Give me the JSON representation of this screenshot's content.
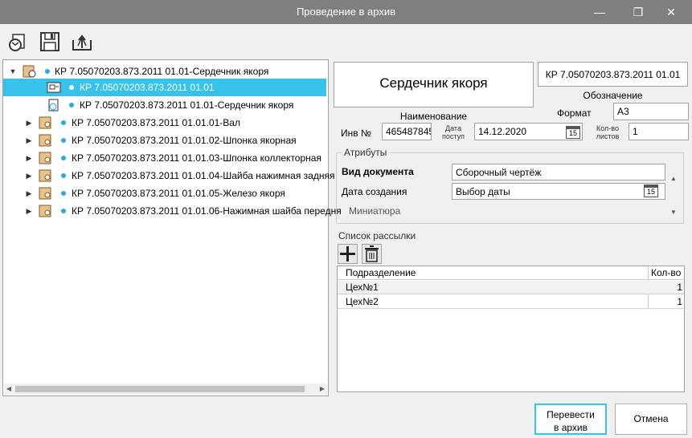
{
  "window": {
    "title": "Проведение в архив"
  },
  "tree": {
    "items": [
      {
        "label": "КР 7.05070203.873.2011 01.01-Сердечник якоря"
      },
      {
        "label": "КР 7.05070203.873.2011 01.01"
      },
      {
        "label": "КР 7.05070203.873.2011 01.01-Сердечник якоря"
      },
      {
        "label": "КР 7.05070203.873.2011 01.01.01-Вал"
      },
      {
        "label": "КР 7.05070203.873.2011 01.01.02-Шпонка якорная"
      },
      {
        "label": "КР 7.05070203.873.2011 01.01.03-Шпонка коллекторная"
      },
      {
        "label": "КР 7.05070203.873.2011 01.01.04-Шайба нажимная задняя"
      },
      {
        "label": "КР 7.05070203.873.2011 01.01.05-Железо якоря"
      },
      {
        "label": "КР 7.05070203.873.2011 01.01.06-Нажимная шайба передня"
      }
    ]
  },
  "card": {
    "name_value": "Сердечник якоря",
    "name_label": "Наименование",
    "designation_value": "КР 7.05070203.873.2011 01.01",
    "designation_label": "Обозначение",
    "format_label": "Формат",
    "format_value": "А3",
    "inv_label": "Инв №",
    "inv_value": "465487845",
    "date_label": "Дата поступ",
    "date_value": "14.12.2020",
    "date_icon_text": "15",
    "sheets_label": "Кол-во листов",
    "sheets_value": "1"
  },
  "attributes": {
    "title": "Атрибуты",
    "doc_type_label": "Вид документа",
    "doc_type_value": "Сборочный чертёж",
    "created_label": "Дата создания",
    "created_value": "Выбор даты",
    "created_icon_text": "15",
    "thumbnail_label": "Миниатюра"
  },
  "mailing": {
    "title": "Список рассылки",
    "columns": [
      "Подразделение",
      "Кол-во"
    ],
    "rows": [
      {
        "dept": "Цех№1",
        "qty": "1"
      },
      {
        "dept": "Цех№2",
        "qty": "1"
      }
    ]
  },
  "buttons": {
    "archive_line1": "Перевести",
    "archive_line2": "в архив",
    "cancel": "Отмена"
  }
}
